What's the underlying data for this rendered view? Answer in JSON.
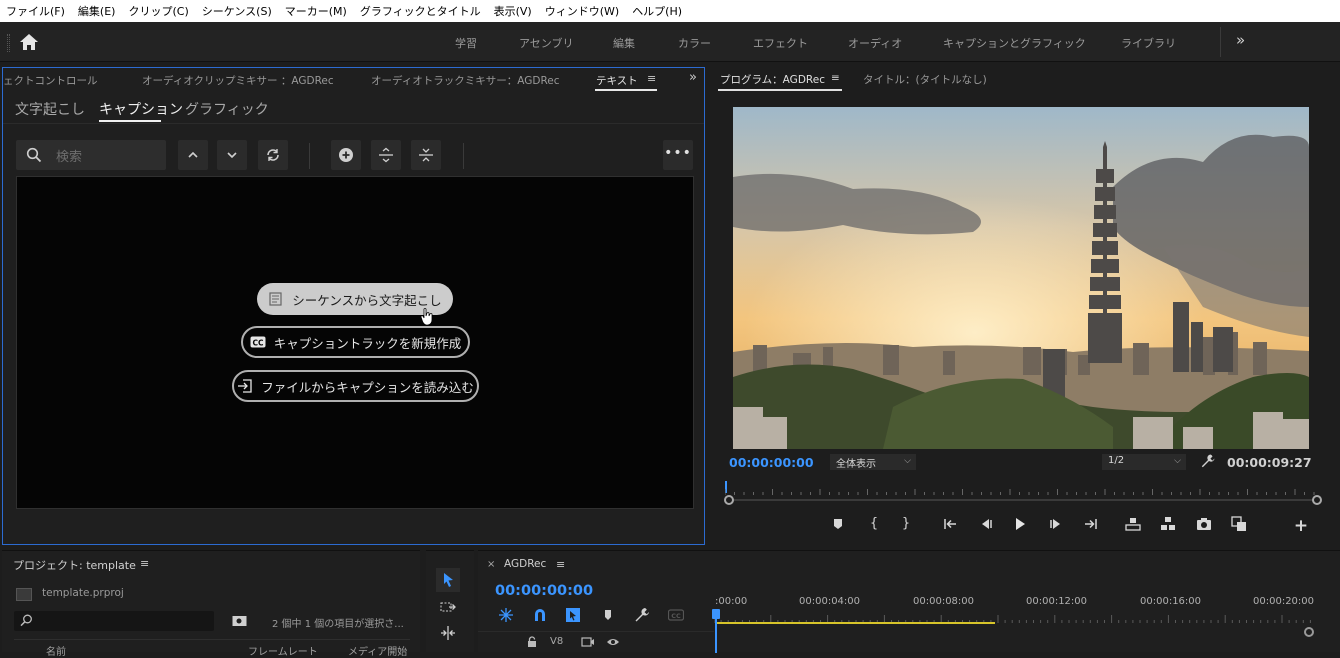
{
  "menubar": [
    "ファイル(F)",
    "編集(E)",
    "クリップ(C)",
    "シーケンス(S)",
    "マーカー(M)",
    "グラフィックとタイトル",
    "表示(V)",
    "ウィンドウ(W)",
    "ヘルプ(H)"
  ],
  "workspaces": [
    "学習",
    "アセンブリ",
    "編集",
    "カラー",
    "エフェクト",
    "オーディオ",
    "キャプションとグラフィック",
    "ライブラリ"
  ],
  "text_panel": {
    "tabs": [
      "ェクトコントロール",
      "オーディオクリップミキサー ：AGDRec",
      "オーディオトラックミキサー：AGDRec",
      "テキスト"
    ],
    "subtabs": [
      "文字起こし",
      "キャプション",
      "グラフィック"
    ],
    "search_placeholder": "検索",
    "actions": {
      "transcribe": "シーケンスから文字起こし",
      "new_track": "キャプショントラックを新規作成",
      "import_file": "ファイルからキャプションを読み込む"
    }
  },
  "program": {
    "tab": "プログラム：AGDRec",
    "tab2": "タイトル：(タイトルなし)",
    "timecode_current": "00:00:00:00",
    "fit": "全体表示",
    "resolution": "1/2",
    "timecode_duration": "00:00:09:27"
  },
  "project": {
    "title": "プロジェクト: template",
    "file": "template.prproj",
    "count": "2 個中 1 個の項目が選択さ...",
    "cols": [
      "名前",
      "フレームレート",
      "メディア開始"
    ]
  },
  "timeline": {
    "sequence": "AGDRec",
    "timecode": "00:00:00:00",
    "ruler": [
      ":00:00",
      "00:00:04:00",
      "00:00:08:00",
      "00:00:12:00",
      "00:00:16:00",
      "00:00:20:00"
    ],
    "track": "V8"
  }
}
